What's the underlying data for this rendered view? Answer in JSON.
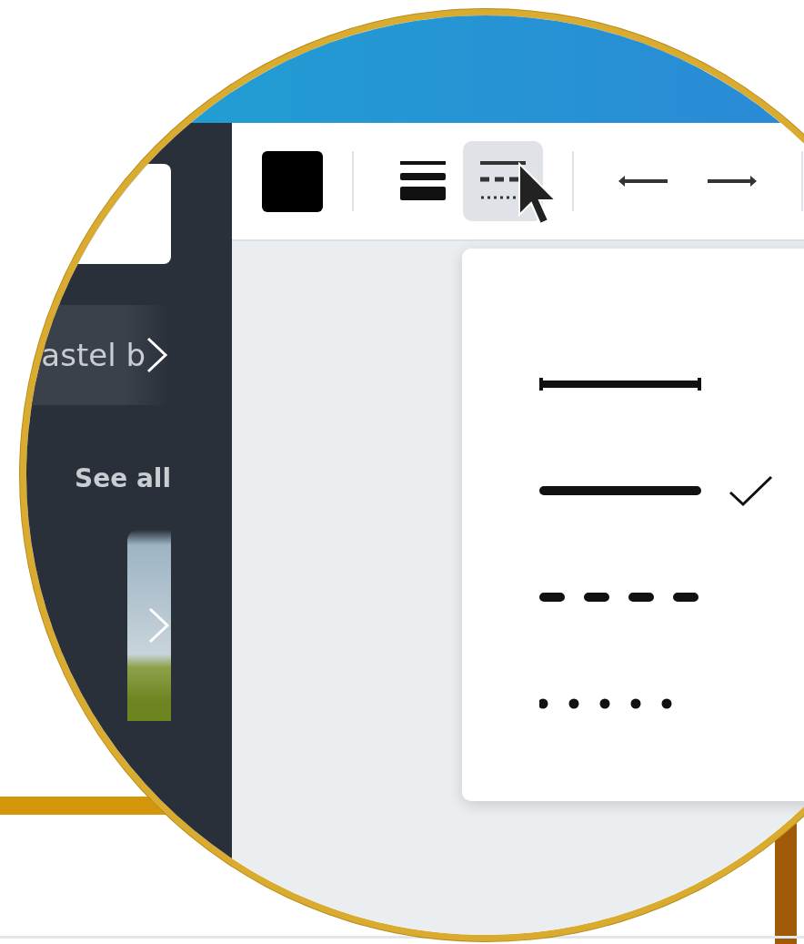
{
  "sidebar": {
    "chip": {
      "label": "astel b"
    },
    "see_all": "See all"
  },
  "toolbar": {
    "tools": [
      {
        "kind": "weight",
        "selected": false
      },
      {
        "kind": "style",
        "selected": true
      },
      {
        "kind": "start",
        "selected": false
      },
      {
        "kind": "end",
        "selected": false
      }
    ]
  },
  "style_menu": {
    "items": [
      {
        "kind": "capped",
        "checked": false
      },
      {
        "kind": "solid",
        "checked": true
      },
      {
        "kind": "dashed",
        "checked": false
      },
      {
        "kind": "dotted",
        "checked": false
      }
    ]
  }
}
